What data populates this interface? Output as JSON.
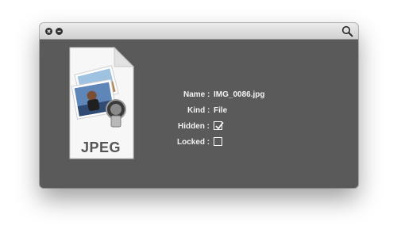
{
  "window": {
    "icon_caption": "JPEG",
    "toolbar": {
      "close": "close-button",
      "minimize": "minimize-button",
      "search": "search-icon"
    }
  },
  "info": {
    "name_label": "Name :",
    "name_value": "IMG_0086.jpg",
    "kind_label": "Kind :",
    "kind_value": "File",
    "hidden_label": "Hidden :",
    "hidden_checked": true,
    "locked_label": "Locked :",
    "locked_checked": false
  }
}
